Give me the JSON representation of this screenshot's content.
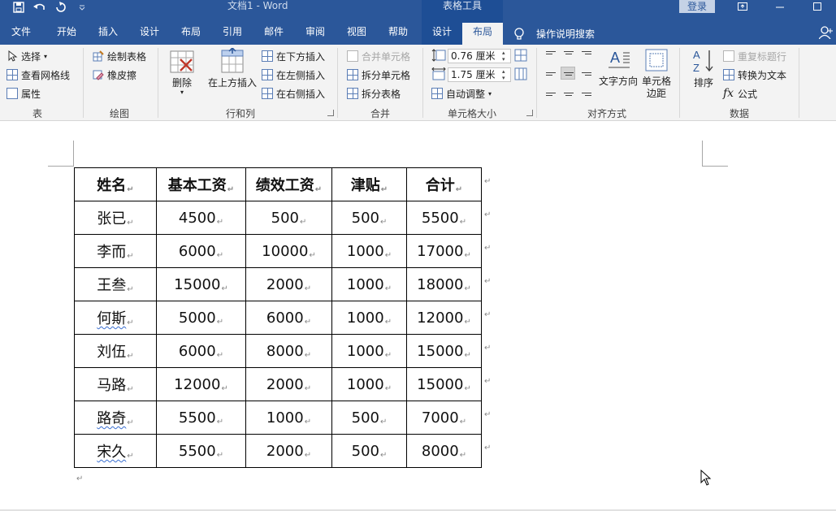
{
  "titlebar": {
    "doc_title": "文档1  -  Word",
    "context_title": "表格工具",
    "login_label": "登录"
  },
  "tabs": [
    "文件",
    "开始",
    "插入",
    "设计",
    "布局",
    "引用",
    "邮件",
    "审阅",
    "视图",
    "帮助"
  ],
  "context_tabs": [
    "设计",
    "布局"
  ],
  "tell_me": "操作说明搜索",
  "ribbon": {
    "group_table": {
      "label": "表",
      "select": "选择",
      "view_gridlines": "查看网格线",
      "properties": "属性"
    },
    "group_draw": {
      "label": "绘图",
      "draw_table": "绘制表格",
      "eraser": "橡皮擦"
    },
    "group_rows_cols": {
      "label": "行和列",
      "delete": "删除",
      "insert_above": "在上方插入",
      "insert_below": "在下方插入",
      "insert_left": "在左侧插入",
      "insert_right": "在右侧插入"
    },
    "group_merge": {
      "label": "合并",
      "merge_cells": "合并单元格",
      "split_cells": "拆分单元格",
      "split_table": "拆分表格"
    },
    "group_cell_size": {
      "label": "单元格大小",
      "height": "0.76 厘米",
      "width": "1.75 厘米",
      "autofit": "自动调整"
    },
    "group_alignment": {
      "label": "对齐方式",
      "text_direction": "文字方向",
      "cell_margins_1": "单元格",
      "cell_margins_2": "边距"
    },
    "group_data": {
      "label": "数据",
      "sort": "排序",
      "repeat_header": "重复标题行",
      "convert_text": "转换为文本",
      "formula": "公式"
    }
  },
  "table": {
    "headers": [
      "姓名",
      "基本工资",
      "绩效工资",
      "津贴",
      "合计"
    ],
    "rows": [
      [
        "张已",
        "4500",
        "500",
        "500",
        "5500"
      ],
      [
        "李而",
        "6000",
        "10000",
        "1000",
        "17000"
      ],
      [
        "王叁",
        "15000",
        "2000",
        "1000",
        "18000"
      ],
      [
        "何斯",
        "5000",
        "6000",
        "1000",
        "12000"
      ],
      [
        "刘伍",
        "6000",
        "8000",
        "1000",
        "15000"
      ],
      [
        "马路",
        "12000",
        "2000",
        "1000",
        "15000"
      ],
      [
        "路奇",
        "5500",
        "1000",
        "500",
        "7000"
      ],
      [
        "宋久",
        "5500",
        "2000",
        "500",
        "8000"
      ]
    ]
  },
  "colors": {
    "accent": "#2b579a",
    "ribbon_bg": "#f3f3f3"
  }
}
